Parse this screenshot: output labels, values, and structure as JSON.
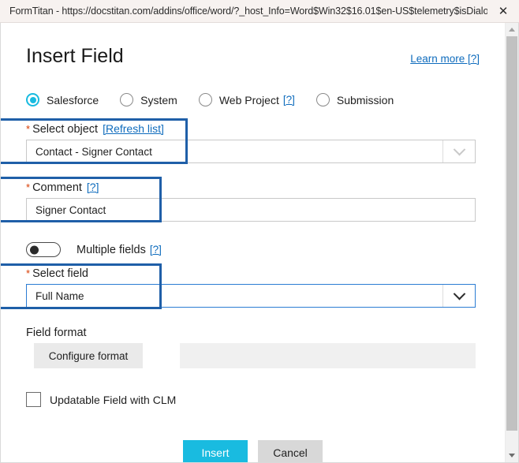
{
  "window": {
    "title": "FormTitan - https://docstitan.com/addins/office/word/?_host_Info=Word$Win32$16.01$en-US$telemetry$isDialog...",
    "close_label": "✕"
  },
  "header": {
    "title": "Insert Field",
    "learn_more": "Learn more [?]"
  },
  "source_radios": {
    "options": [
      {
        "label": "Salesforce",
        "checked": true,
        "help": ""
      },
      {
        "label": "System",
        "checked": false,
        "help": ""
      },
      {
        "label": "Web Project",
        "checked": false,
        "help": "[?]"
      },
      {
        "label": "Submission",
        "checked": false,
        "help": ""
      }
    ]
  },
  "select_object": {
    "label": "Select object",
    "required_marker": "*",
    "refresh_link": "[Refresh list]",
    "value": "Contact - Signer Contact",
    "highlighted": true
  },
  "comment": {
    "label": "Comment",
    "required_marker": "*",
    "help_link": "[?]",
    "value": "Signer Contact",
    "highlighted": true
  },
  "multiple_fields": {
    "label": "Multiple fields",
    "help_link": "[?]",
    "enabled": false
  },
  "select_field": {
    "label": "Select field",
    "required_marker": "*",
    "value": "Full Name",
    "highlighted": true,
    "focused": true
  },
  "field_format": {
    "label": "Field format",
    "configure_button": "Configure format",
    "readonly_value": ""
  },
  "updatable_checkbox": {
    "label": "Updatable Field with CLM",
    "checked": false
  },
  "footer": {
    "primary": "Insert",
    "secondary": "Cancel"
  },
  "colors": {
    "accent": "#19bbe0",
    "link": "#0f6cbd",
    "highlight_box": "#1f5fa8",
    "required": "#d83b01",
    "focus_border": "#2b7cd3"
  },
  "scrollbar": {
    "up_arrow": "▲",
    "down_arrow": "▼"
  }
}
